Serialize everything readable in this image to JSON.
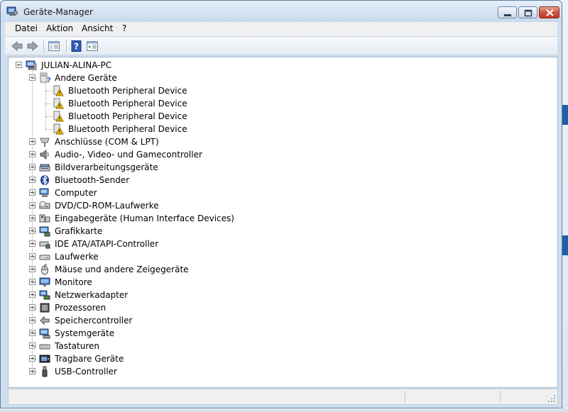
{
  "window": {
    "title": "Geräte-Manager"
  },
  "menu": [
    "Datei",
    "Aktion",
    "Ansicht",
    "?"
  ],
  "toolbar": {
    "back_icon": "arrow-left-icon",
    "forward_icon": "arrow-right-icon",
    "tree_view_icon": "console-tree-icon",
    "help_icon": "help-icon",
    "properties_icon": "properties-icon"
  },
  "tree": {
    "root": "JULIAN-ALINA-PC",
    "other_devices": {
      "label": "Andere Geräte",
      "children": [
        "Bluetooth Peripheral Device",
        "Bluetooth Peripheral Device",
        "Bluetooth Peripheral Device",
        "Bluetooth Peripheral Device"
      ]
    },
    "categories": [
      {
        "label": "Anschlüsse (COM & LPT)",
        "icon": "port-icon"
      },
      {
        "label": "Audio-, Video- und Gamecontroller",
        "icon": "speaker-icon"
      },
      {
        "label": "Bildverarbeitungsgeräte",
        "icon": "scanner-icon"
      },
      {
        "label": "Bluetooth-Sender",
        "icon": "bluetooth-icon"
      },
      {
        "label": "Computer",
        "icon": "computer-icon"
      },
      {
        "label": "DVD/CD-ROM-Laufwerke",
        "icon": "dvd-drive-icon"
      },
      {
        "label": "Eingabegeräte (Human Interface Devices)",
        "icon": "hid-icon"
      },
      {
        "label": "Grafikkarte",
        "icon": "display-adapter-icon"
      },
      {
        "label": "IDE ATA/ATAPI-Controller",
        "icon": "ide-controller-icon"
      },
      {
        "label": "Laufwerke",
        "icon": "disk-drive-icon"
      },
      {
        "label": "Mäuse und andere Zeigegeräte",
        "icon": "mouse-icon"
      },
      {
        "label": "Monitore",
        "icon": "monitor-icon"
      },
      {
        "label": "Netzwerkadapter",
        "icon": "network-adapter-icon"
      },
      {
        "label": "Prozessoren",
        "icon": "processor-icon"
      },
      {
        "label": "Speichercontroller",
        "icon": "storage-controller-icon"
      },
      {
        "label": "Systemgeräte",
        "icon": "system-devices-icon"
      },
      {
        "label": "Tastaturen",
        "icon": "keyboard-icon"
      },
      {
        "label": "Tragbare Geräte",
        "icon": "portable-device-icon"
      },
      {
        "label": "USB-Controller",
        "icon": "usb-icon"
      }
    ]
  },
  "colors": {
    "title_bar": "#d6e3f2",
    "close_button": "#c0372a",
    "warning": "#f2c200"
  }
}
